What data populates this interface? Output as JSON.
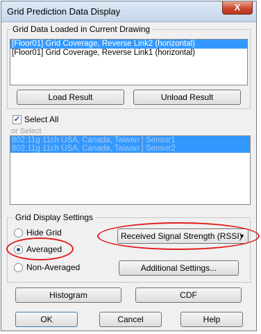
{
  "window": {
    "title": "Grid Prediction Data Display",
    "close_label": "X"
  },
  "grid_data": {
    "group_label": "Grid Data Loaded in Current Drawing",
    "items": [
      {
        "label": "[Floor01] Grid Coverage, Reverse Link2 (horizontal)",
        "selected": true
      },
      {
        "label": "[Floor01] Grid Coverage, Reverse Link1 (horizontal)",
        "selected": false
      }
    ],
    "load_button": "Load Result",
    "unload_button": "Unload Result"
  },
  "selection": {
    "select_all_label": "Select All",
    "select_all_checked": true,
    "or_select_label": "or Select",
    "sensors": [
      "802.11g 11ch USA, Canada, Taiwan | Sensor1",
      "802.11g 11ch USA, Canada, Taiwan | Sensor2"
    ]
  },
  "display_settings": {
    "group_label": "Grid Display Settings",
    "options": [
      {
        "label": "Hide Grid",
        "checked": false
      },
      {
        "label": "Averaged",
        "checked": true
      },
      {
        "label": "Non-Averaged",
        "checked": false
      }
    ],
    "metric_select": "Received Signal Strength (RSSI)",
    "additional_settings_button": "Additional Settings...",
    "highlight_color": "#e11b1b"
  },
  "actions": {
    "histogram_button": "Histogram",
    "cdf_button": "CDF",
    "ok_button": "OK",
    "cancel_button": "Cancel",
    "help_button": "Help"
  },
  "colors": {
    "selection": "#3399ff",
    "window_bg": "#f0f0f0"
  }
}
